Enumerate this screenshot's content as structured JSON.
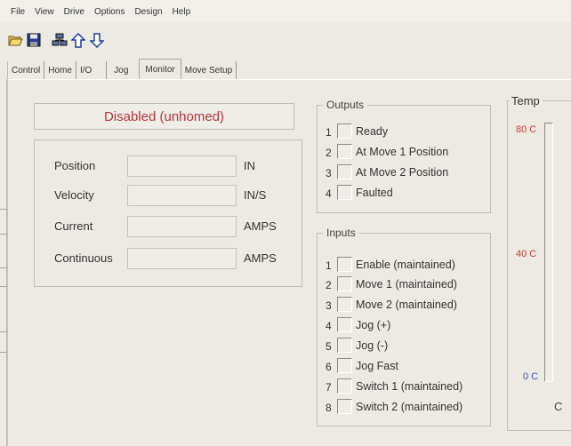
{
  "menu": {
    "items": [
      "File",
      "View",
      "Drive",
      "Options",
      "Design",
      "Help"
    ]
  },
  "toolbar": {
    "buttons": [
      {
        "icon": "open-folder-icon"
      },
      {
        "icon": "save-disk-icon"
      },
      {
        "icon": "network-drives-icon"
      },
      {
        "icon": "upload-arrow-icon"
      },
      {
        "icon": "download-arrow-icon"
      }
    ]
  },
  "tabs": [
    {
      "label": "Control"
    },
    {
      "label": "Home"
    },
    {
      "label": "I/O"
    },
    {
      "label": "Jog"
    },
    {
      "label": "Monitor",
      "active": true
    },
    {
      "label": "Move Setup"
    }
  ],
  "status": {
    "text": "Disabled (unhomed)",
    "color": "#b4343a"
  },
  "readings": [
    {
      "label": "Position",
      "value": "",
      "unit": "IN"
    },
    {
      "label": "Velocity",
      "value": "",
      "unit": "IN/S"
    },
    {
      "label": "Current",
      "value": "",
      "unit": "AMPS"
    },
    {
      "label": "Continuous",
      "value": "",
      "unit": "AMPS"
    }
  ],
  "outputs": {
    "title": "Outputs",
    "items": [
      {
        "num": "1",
        "label": "Ready"
      },
      {
        "num": "2",
        "label": "At Move 1 Position"
      },
      {
        "num": "3",
        "label": "At Move 2 Position"
      },
      {
        "num": "4",
        "label": "Faulted"
      }
    ]
  },
  "inputs": {
    "title": "Inputs",
    "items": [
      {
        "num": "1",
        "label": "Enable (maintained)"
      },
      {
        "num": "2",
        "label": "Move 1 (maintained)"
      },
      {
        "num": "3",
        "label": "Move 2 (maintained)"
      },
      {
        "num": "4",
        "label": "Jog (+)"
      },
      {
        "num": "5",
        "label": "Jog (-)"
      },
      {
        "num": "6",
        "label": "Jog Fast"
      },
      {
        "num": "7",
        "label": "Switch 1 (maintained)"
      },
      {
        "num": "8",
        "label": "Switch 2 (maintained)"
      }
    ]
  },
  "temperature": {
    "title": "Temp",
    "max_label": "80 C",
    "mid_label": "40 C",
    "min_label": "0 C",
    "unit": "C",
    "colors": {
      "hot": "#c23b3b",
      "cold": "#3b4fb4"
    }
  }
}
